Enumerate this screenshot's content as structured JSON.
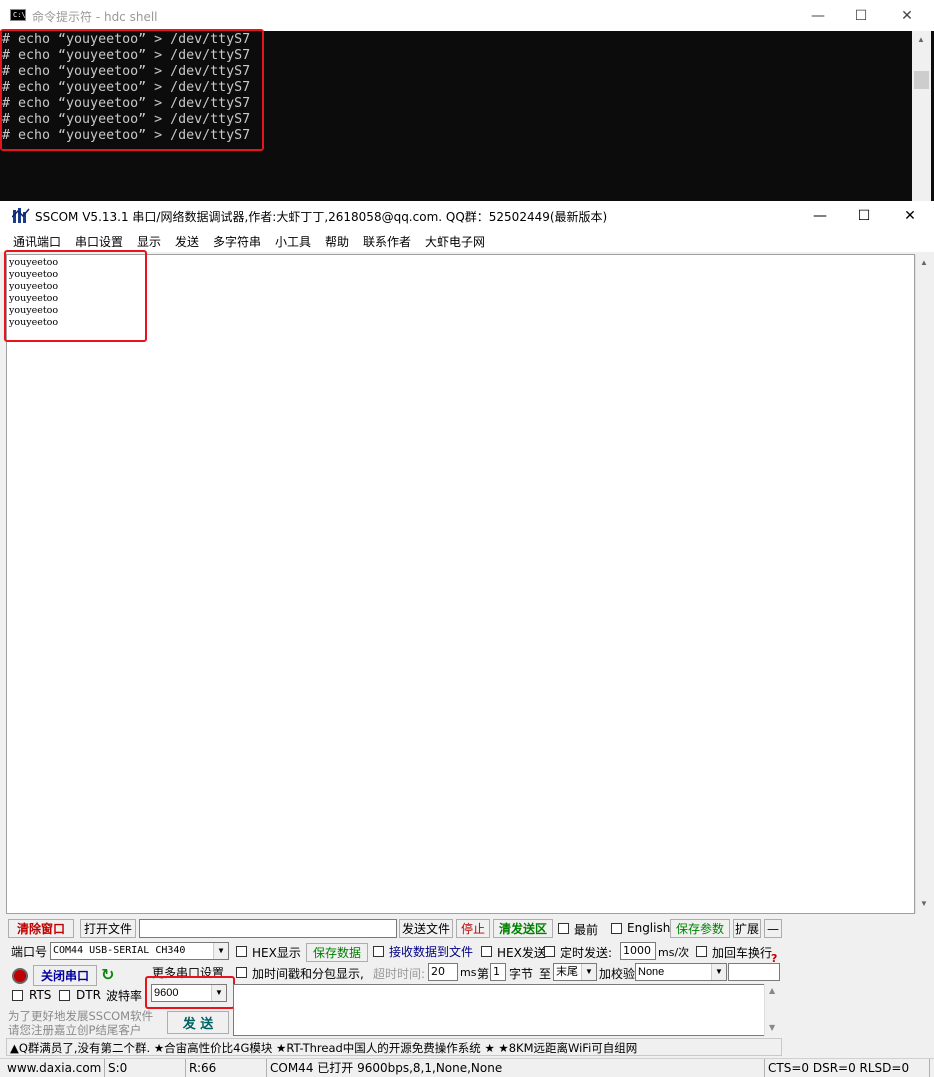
{
  "cmd": {
    "title": "命令提示符 - hdc  shell",
    "icon": "cmd-console-icon",
    "lines": [
      "# echo “youyeetoo” > /dev/ttyS7",
      "# echo “youyeetoo” > /dev/ttyS7",
      "# echo “youyeetoo” > /dev/ttyS7",
      "# echo “youyeetoo” > /dev/ttyS7",
      "# echo “youyeetoo” > /dev/ttyS7",
      "# echo “youyeetoo” > /dev/ttyS7",
      "# echo “youyeetoo” > /dev/ttyS7"
    ]
  },
  "sscom": {
    "title": "SSCOM V5.13.1 串口/网络数据调试器,作者:大虾丁丁,2618058@qq.com. QQ群：52502449(最新版本)",
    "menu": [
      "通讯端口",
      "串口设置",
      "显示",
      "发送",
      "多字符串",
      "小工具",
      "帮助",
      "联系作者",
      "大虾电子网"
    ],
    "received": [
      "youyeetoo",
      "youyeetoo",
      "youyeetoo",
      "youyeetoo",
      "youyeetoo",
      "youyeetoo"
    ],
    "toolbar": {
      "clear_window": "清除窗口",
      "open_file": "打开文件",
      "file_path": "",
      "send_file": "发送文件",
      "stop": "停止",
      "clear_send": "清发送区",
      "last": "最前",
      "english": "English",
      "save_params": "保存参数",
      "expand": "扩展",
      "minus": "—"
    },
    "port": {
      "label": "端口号",
      "value": "COM44 USB-SERIAL CH340",
      "hex_display": "HEX显示",
      "save_data": "保存数据",
      "recv_to_file": "接收数据到文件",
      "hex_send": "HEX发送",
      "timed_send": "定时发送:",
      "interval": "1000",
      "interval_unit": "ms/次",
      "add_crlf": "加回车换行",
      "close_port": "关闭串口",
      "more_settings": "更多串口设置",
      "timestamp": "加时间戳和分包显示,",
      "timeout_label": "超时时间:",
      "timeout": "20",
      "ms": "ms",
      "nth": "第",
      "byte_index": "1",
      "byte": "字节",
      "to": "至",
      "end": "末尾",
      "checksum": "加校验",
      "checksum_value": "None",
      "rts": "RTS",
      "dtr": "DTR",
      "baud_label": "波特率",
      "baud": "9600",
      "promo1": "为了更好地发展SSCOM软件",
      "promo2": "请您注册嘉立创P结尾客户",
      "send": "发 送"
    },
    "ticker": "▲Q群满员了,没有第二个群. ★合宙高性价比4G模块 ★RT-Thread中国人的开源免费操作系统 ★ ★8KM远距离WiFi可自组网",
    "status": {
      "site": "www.daxia.com",
      "s": "S:0",
      "r": "R:66",
      "port_state": "COM44 已打开  9600bps,8,1,None,None",
      "lines": "CTS=0 DSR=0 RLSD=0"
    }
  },
  "colors": {
    "highlight": "#e8141b",
    "save_green": "#008000",
    "clear_red": "#c00000"
  }
}
